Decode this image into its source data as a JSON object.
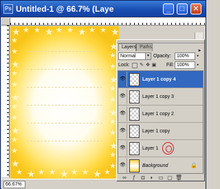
{
  "window": {
    "title": "Untitled-1 @ 66.7% (Layer ...",
    "app_icon": "photoshop-document-icon",
    "buttons": {
      "minimize": "_",
      "maximize": "□",
      "close": "✕"
    },
    "zoom_status": "66.67%"
  },
  "canvas": {
    "background_colors": {
      "edge": "#f8c419",
      "center": "#ffffff"
    },
    "decoration": "star-border"
  },
  "layers_panel": {
    "tabs": [
      "Layers",
      "Paths"
    ],
    "active_tab": "Layers",
    "blend_mode": "Normal",
    "opacity_label": "Opacity:",
    "opacity_value": "100%",
    "lock_label": "Lock:",
    "fill_label": "Fill:",
    "fill_value": "100%",
    "layers": [
      {
        "name": "Layer 1 copy 4",
        "selected": true
      },
      {
        "name": "Layer 1 copy 3",
        "selected": false
      },
      {
        "name": "Layer 1 copy 2",
        "selected": false
      },
      {
        "name": "Layer 1 copy",
        "selected": false
      },
      {
        "name": "Layer 1",
        "selected": false,
        "annotated": true
      },
      {
        "name": "Background",
        "selected": false,
        "locked": true
      }
    ]
  },
  "colors": {
    "titlebar": "#2458d0",
    "selection": "#3268c0",
    "canvas_yellow": "#ffd63a"
  }
}
